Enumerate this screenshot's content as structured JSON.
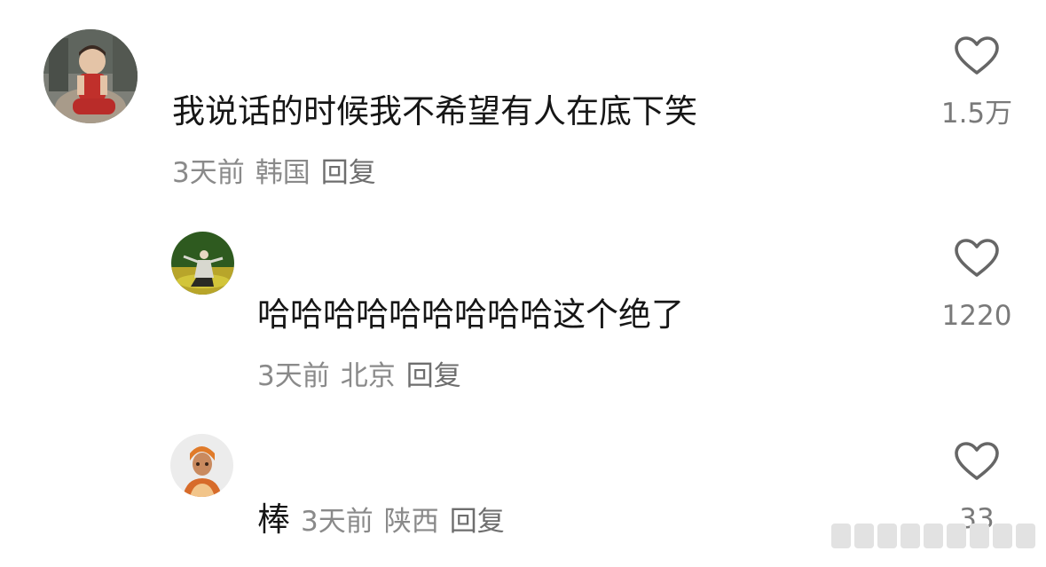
{
  "comments": [
    {
      "text": "我说话的时候我不希望有人在底下笑",
      "time": "3天前",
      "location": "韩国",
      "reply_label": "回复",
      "likes": "1.5万",
      "avatar_icon": "child-photo-avatar"
    },
    {
      "text": "哈哈哈哈哈哈哈哈哈这个绝了",
      "time": "3天前",
      "location": "北京",
      "reply_label": "回复",
      "likes": "1220",
      "avatar_icon": "dancer-on-grass-avatar"
    },
    {
      "text": "棒",
      "time": "3天前",
      "location": "陕西",
      "reply_label": "回复",
      "likes": "33",
      "avatar_icon": "person-headscarf-avatar"
    }
  ],
  "icons": {
    "like": "heart-outline-icon"
  },
  "colors": {
    "text": "#161616",
    "meta": "#8a8a8a",
    "heart_stroke": "#666666"
  }
}
